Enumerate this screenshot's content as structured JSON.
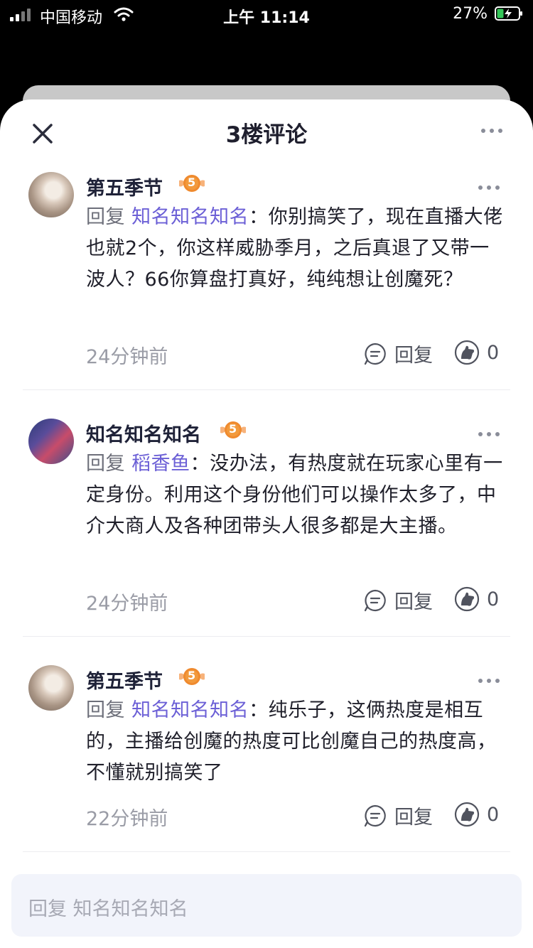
{
  "status_bar": {
    "carrier": "中国移动",
    "time": "上午 11:14",
    "battery": "27%"
  },
  "sheet": {
    "title": "3楼评论"
  },
  "comments": [
    {
      "username": "第五季节",
      "level": "5",
      "reply_prefix": "回复",
      "reply_to": "知名知名知名",
      "text": "：你别搞笑了，现在直播大佬也就2个，你这样威胁季月，之后真退了又带一波人？66你算盘打真好，纯纯想让创魔死？",
      "timestamp": "24分钟前",
      "reply_label": "回复",
      "likes": "0"
    },
    {
      "username": "知名知名知名",
      "level": "5",
      "reply_prefix": "回复",
      "reply_to": "稻香鱼",
      "text": "：没办法，有热度就在玩家心里有一定身份。利用这个身份他们可以操作太多了，中介大商人及各种团带头人很多都是大主播。",
      "timestamp": "24分钟前",
      "reply_label": "回复",
      "likes": "0"
    },
    {
      "username": "第五季节",
      "level": "5",
      "reply_prefix": "回复",
      "reply_to": "知名知名知名",
      "text": "：纯乐子，这俩热度是相互的，主播给创魔的热度可比创魔自己的热度高，不懂就别搞笑了",
      "timestamp": "22分钟前",
      "reply_label": "回复",
      "likes": "0"
    }
  ],
  "reply_input": {
    "placeholder": "回复 知名知名知名"
  },
  "colors": {
    "accent": "#6b5fd6",
    "badge": "#f0a030"
  }
}
